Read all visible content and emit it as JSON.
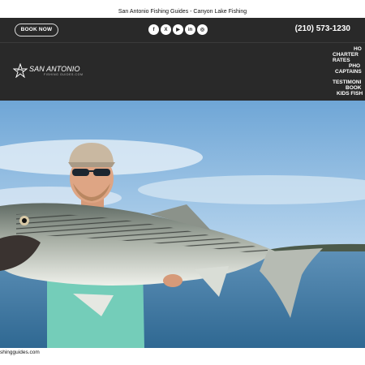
{
  "page_title": "San Antonio Fishing Guides - Canyon Lake Fishing",
  "header": {
    "book_button": "BOOK NOW",
    "phone": "(210) 573-1230",
    "social_icons": [
      "facebook-icon",
      "x-icon",
      "youtube-icon",
      "linkedin-icon",
      "instagram-icon"
    ],
    "logo": {
      "main": "SAN ANTONIO",
      "sub": "FISHING GUIDES.COM"
    }
  },
  "nav": {
    "items": [
      "HO",
      "CHARTER",
      "RATES",
      "PHO",
      "CAPTAINS",
      "TESTIMONI",
      "BOOK",
      "KIDS FISH"
    ]
  },
  "footer": {
    "text": "shingguides.com"
  },
  "colors": {
    "header_bg": "#292929",
    "water": "#3f78a3",
    "sky": "#8ec0e6",
    "shirt": "#74cdb9"
  }
}
